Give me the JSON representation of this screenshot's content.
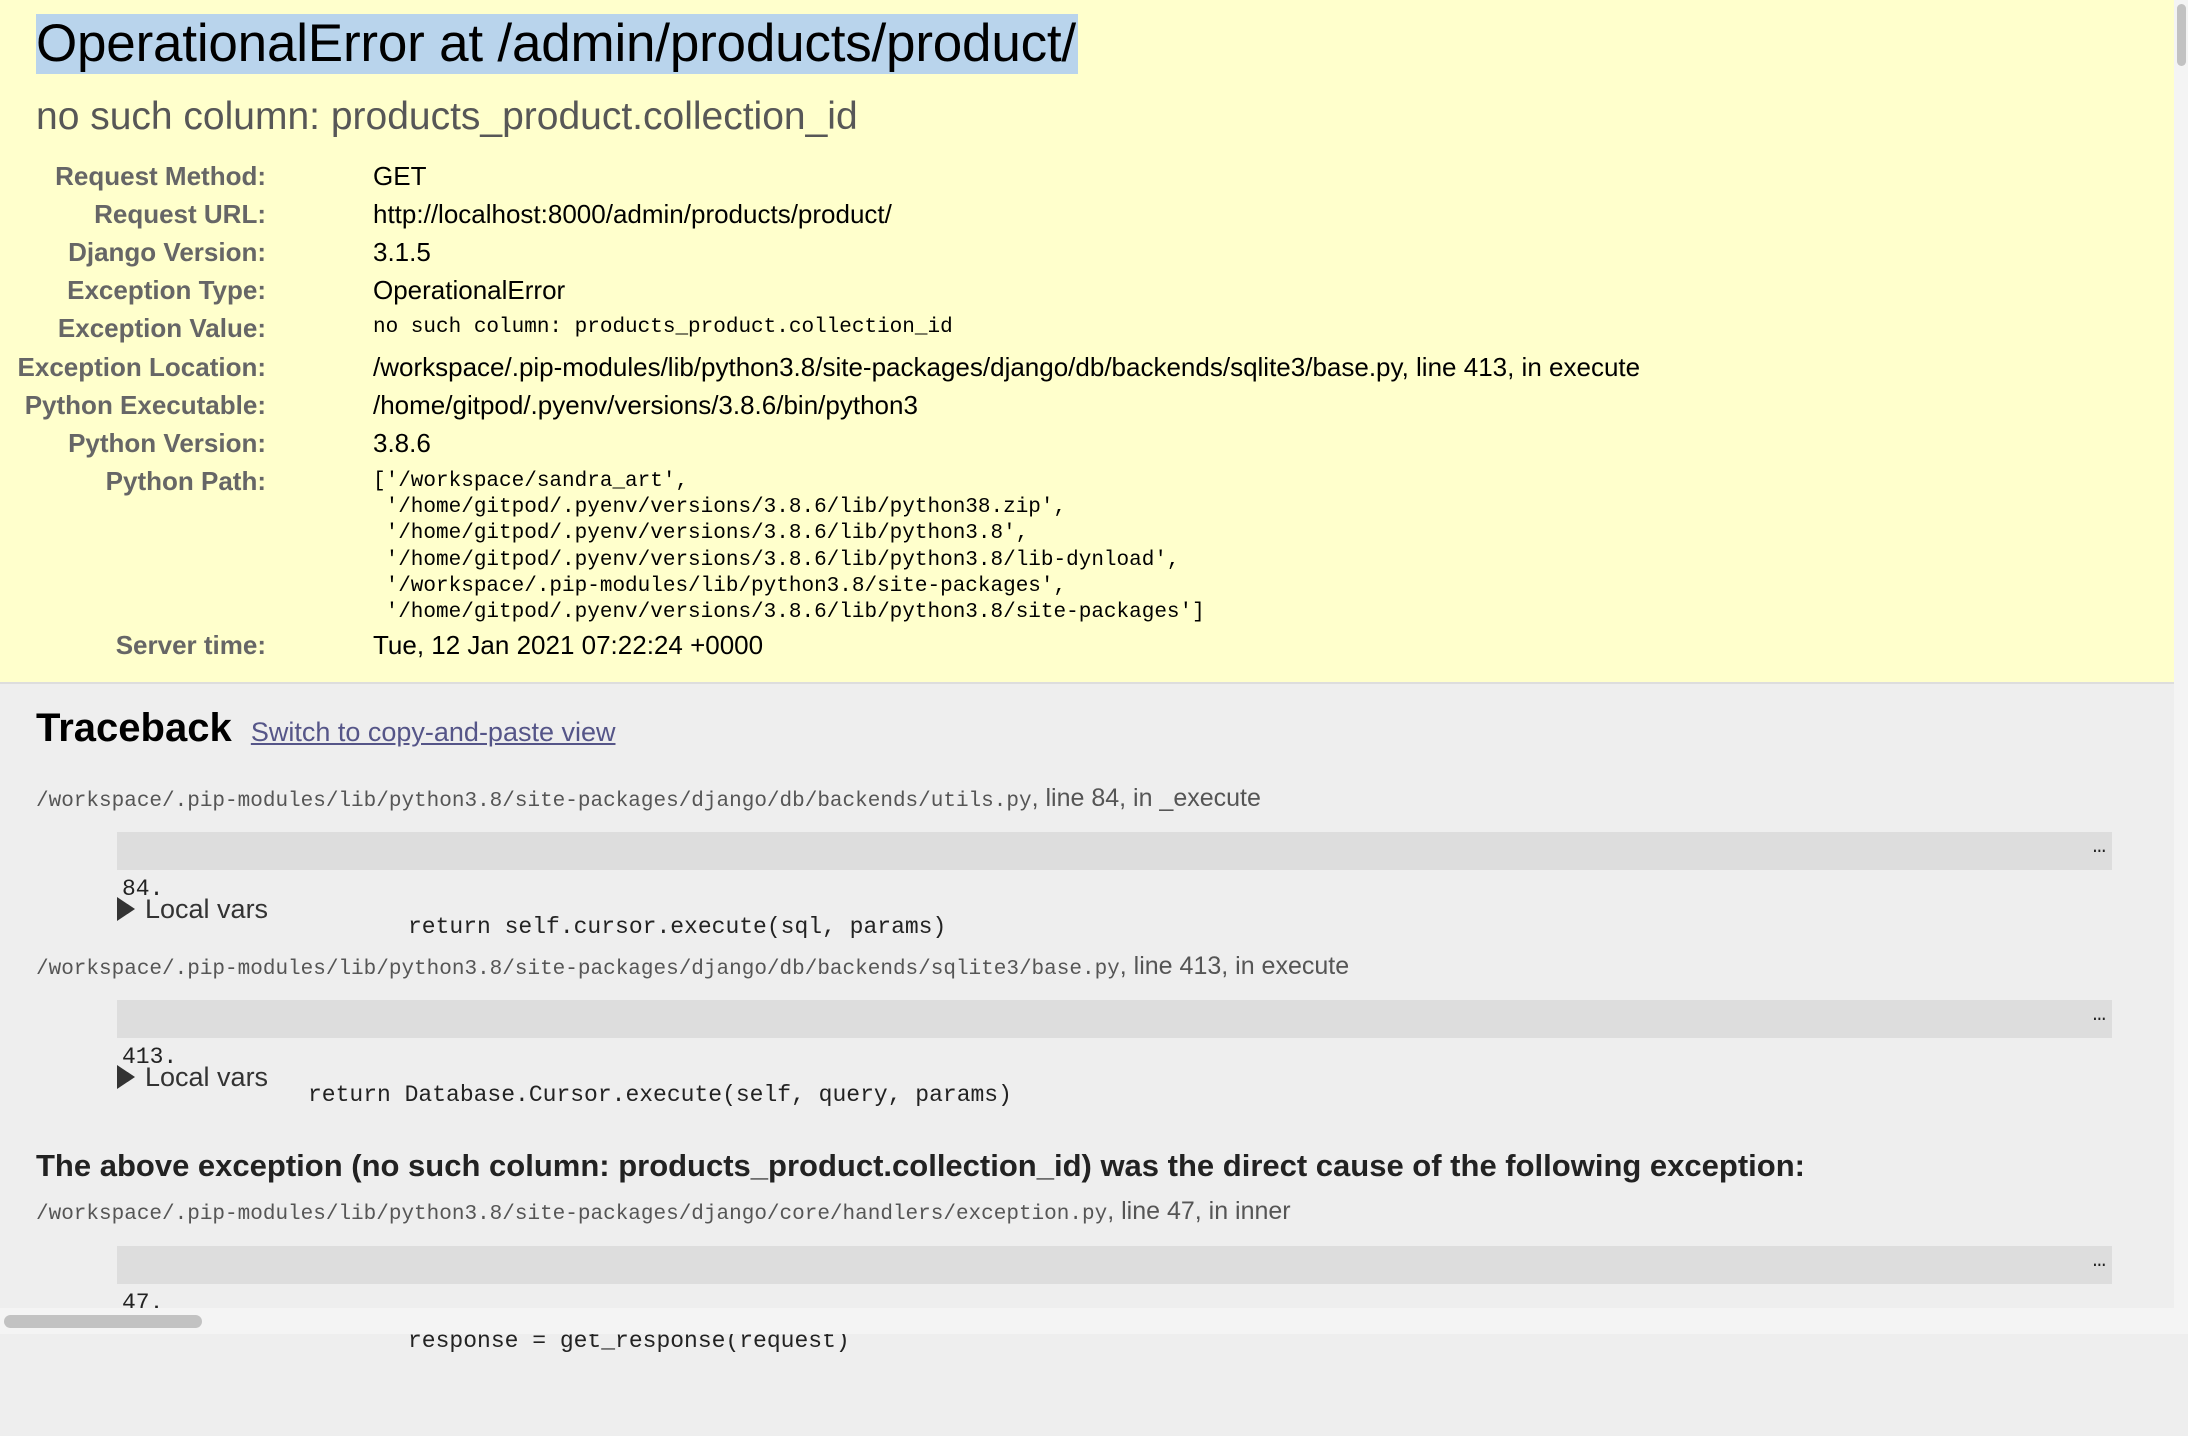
{
  "summary": {
    "title": "OperationalError at /admin/products/product/",
    "subtitle": "no such column: products_product.collection_id",
    "meta": [
      {
        "label": "Request Method:",
        "value": "GET"
      },
      {
        "label": "Request URL:",
        "value": "http://localhost:8000/admin/products/product/"
      },
      {
        "label": "Django Version:",
        "value": "3.1.5"
      },
      {
        "label": "Exception Type:",
        "value": "OperationalError"
      },
      {
        "label": "Exception Value:",
        "value": "no such column: products_product.collection_id"
      },
      {
        "label": "Exception Location:",
        "value": "/workspace/.pip-modules/lib/python3.8/site-packages/django/db/backends/sqlite3/base.py, line 413, in execute"
      },
      {
        "label": "Python Executable:",
        "value": "/home/gitpod/.pyenv/versions/3.8.6/bin/python3"
      },
      {
        "label": "Python Version:",
        "value": "3.8.6"
      },
      {
        "label": "Python Path:",
        "value": "['/workspace/sandra_art',\n '/home/gitpod/.pyenv/versions/3.8.6/lib/python38.zip',\n '/home/gitpod/.pyenv/versions/3.8.6/lib/python3.8',\n '/home/gitpod/.pyenv/versions/3.8.6/lib/python3.8/lib-dynload',\n '/workspace/.pip-modules/lib/python3.8/site-packages',\n '/home/gitpod/.pyenv/versions/3.8.6/lib/python3.8/site-packages']"
      },
      {
        "label": "Server time:",
        "value": "Tue, 12 Jan 2021 07:22:24 +0000"
      }
    ]
  },
  "traceback": {
    "heading": "Traceback",
    "switch_link": "Switch to copy-and-paste view",
    "frames": [
      {
        "path": "/workspace/.pip-modules/lib/python3.8/site-packages/django/db/backends/utils.py",
        "location": ", line 84, in _execute",
        "lineno": "84.",
        "code": "return self.cursor.execute(sql, params)",
        "ellipsis": "…",
        "local_vars": "Local vars"
      },
      {
        "path": "/workspace/.pip-modules/lib/python3.8/site-packages/django/db/backends/sqlite3/base.py",
        "location": ", line 413, in execute",
        "lineno": "413.",
        "code": "return Database.Cursor.execute(self, query, params)",
        "ellipsis": "…",
        "local_vars": "Local vars"
      },
      {
        "path": "/workspace/.pip-modules/lib/python3.8/site-packages/django/core/handlers/exception.py",
        "location": ", line 47, in inner",
        "lineno": "47.",
        "code": "response = get_response(request)",
        "ellipsis": "…"
      }
    ],
    "cause_heading": "The above exception (no such column: products_product.collection_id) was the direct cause of the following exception:"
  }
}
